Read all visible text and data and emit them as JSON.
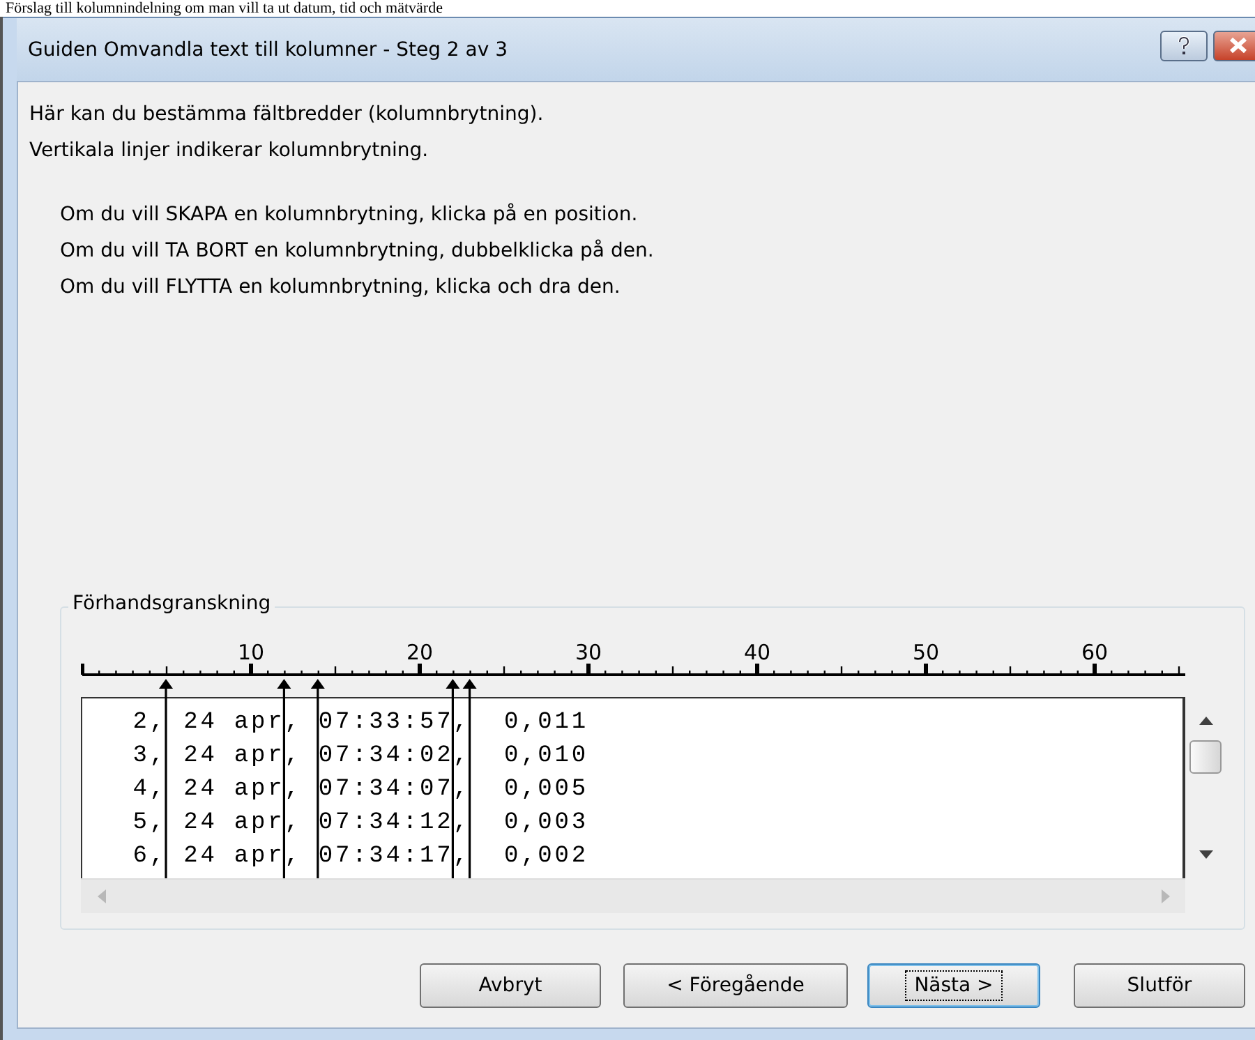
{
  "document_caption": "Förslag till kolumnindelning om man vill ta ut datum, tid och mätvärde",
  "window": {
    "title": "Guiden Omvandla text till kolumner - Steg 2 av 3"
  },
  "intro": [
    "Här kan du bestämma fältbredder (kolumnbrytning).",
    "Vertikala linjer indikerar kolumnbrytning."
  ],
  "instructions": [
    "Om du vill SKAPA en kolumnbrytning, klicka på en position.",
    "Om du vill TA BORT en kolumnbrytning, dubbelklicka på den.",
    "Om du vill FLYTTA en kolumnbrytning, klicka och dra den."
  ],
  "preview": {
    "label": "Förhandsgranskning",
    "ruler_labels": [
      "10",
      "20",
      "30",
      "40",
      "50",
      "60"
    ],
    "rows": [
      {
        "fields": [
          "   2,",
          " 24 apr",
          ", ",
          "07:33:57",
          ",",
          "  0,011"
        ]
      },
      {
        "fields": [
          "   3,",
          " 24 apr",
          ", ",
          "07:34:02",
          ",",
          "  0,010"
        ]
      },
      {
        "fields": [
          "   4,",
          " 24 apr",
          ", ",
          "07:34:07",
          ",",
          "  0,005"
        ]
      },
      {
        "fields": [
          "   5,",
          " 24 apr",
          ", ",
          "07:34:12",
          ",",
          "  0,003"
        ]
      },
      {
        "fields": [
          "   6,",
          " 24 apr",
          ", ",
          "07:34:17",
          ",",
          "  0,002"
        ]
      }
    ]
  },
  "buttons": [
    {
      "label": "Avbryt",
      "default": false
    },
    {
      "label": "< Föregående",
      "default": false
    },
    {
      "label": "Nästa >",
      "default": true
    },
    {
      "label": "Slutför",
      "default": false
    }
  ]
}
